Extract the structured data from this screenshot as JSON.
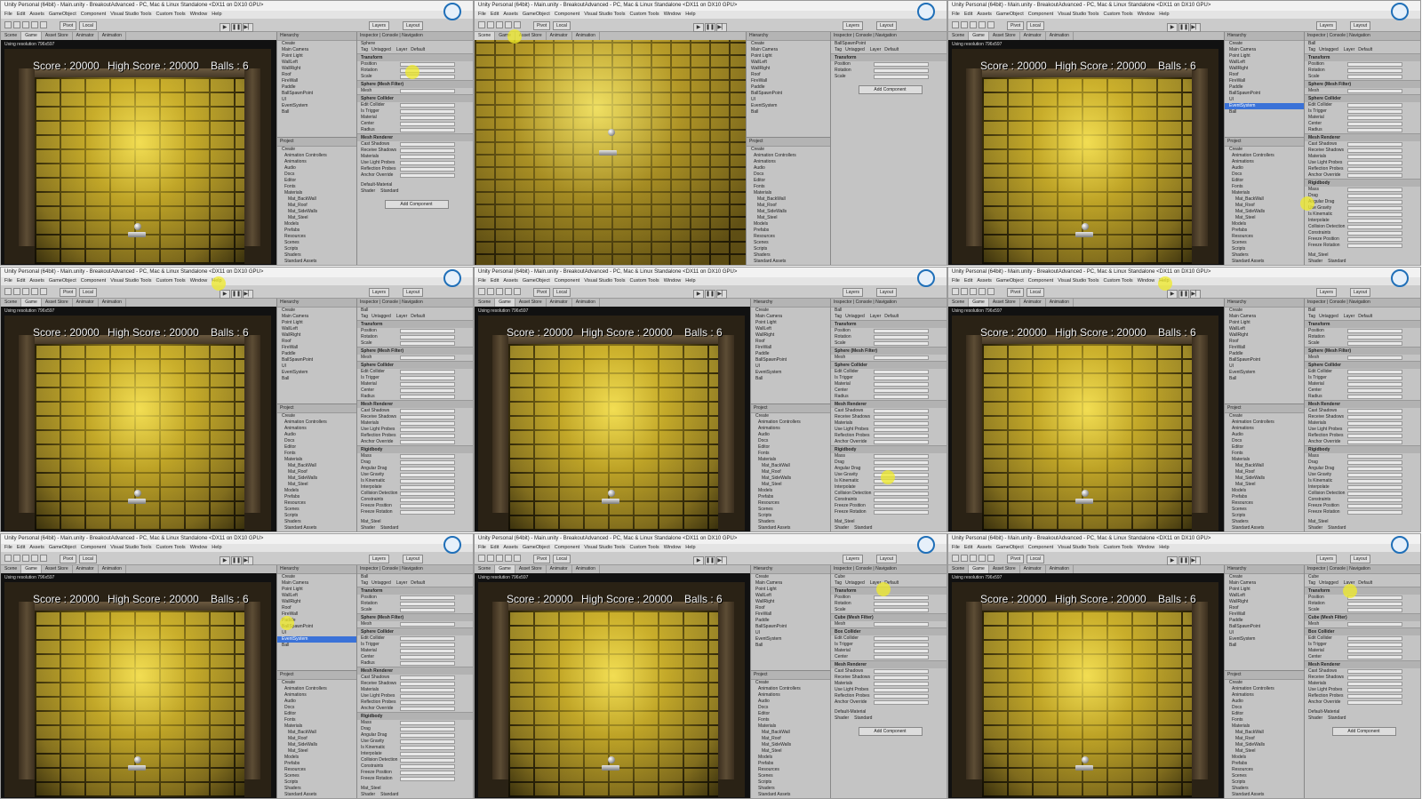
{
  "window": {
    "title": "Unity Personal (64bit) - Main.unity - BreakoutAdvanced - PC, Mac & Linux Standalone <DX11 on DX10 GPU>",
    "menu": [
      "File",
      "Edit",
      "Assets",
      "GameObject",
      "Component",
      "Visual Studio Tools",
      "Custom Tools",
      "Window",
      "Help"
    ]
  },
  "toolbar": {
    "pivot_label": "Pivot",
    "local_label": "Local",
    "layers_label": "Layers",
    "layout_label": "Layout",
    "account_label": "Account"
  },
  "tabs": {
    "scene": "Scene",
    "game": "Game",
    "asset_store": "Asset Store",
    "animator": "Animator",
    "animation": "Animation",
    "hierarchy": "Hierarchy",
    "project": "Project",
    "inspector": "Inspector",
    "console": "Console",
    "navigation": "Navigation"
  },
  "game_view": {
    "display_label": "Standalone (1024x768)",
    "maximize_label": "Maximize on Play",
    "mute_label": "Mute audio",
    "stats_label": "Stats",
    "gizmos_label": "Gizmos",
    "resolution_note": "Using resolution 796x597"
  },
  "hud": {
    "score": "Score : 20000",
    "high_score": "High Score : 20000",
    "balls": "Balls : 6"
  },
  "hierarchy": {
    "create_label": "Create",
    "items": [
      "Main Camera",
      "Point Light",
      "WallLeft",
      "WallRight",
      "Roof",
      "FireWall",
      "Paddle",
      "BallSpawnPoint",
      "UI",
      "EventSystem",
      "Ball"
    ]
  },
  "project": {
    "create_label": "Create",
    "folders": [
      "Animation Controllers",
      "Animations",
      "Audio",
      "Docs",
      "Editor",
      "Fonts",
      "Materials",
      "Mat_BackWall",
      "Mat_Roof",
      "Mat_SideWalls",
      "Mat_Steel",
      "Models",
      "Prefabs",
      "Resources",
      "Scenes",
      "Scripts",
      "Shaders",
      "Standard Assets",
      "Textures",
      "UnityUI"
    ]
  },
  "inspector": {
    "object_sphere": "Sphere",
    "object_ball": "Ball",
    "object_cube": "Cube",
    "object_spawn": "BallSpawnPoint",
    "tag_label": "Tag",
    "untagged": "Untagged",
    "layer_label": "Layer",
    "default_layer": "Default",
    "static_label": "Static",
    "components": {
      "transform": "Transform",
      "sphere_mesh_filter": "Sphere (Mesh Filter)",
      "sphere_collider": "Sphere Collider",
      "mesh_renderer": "Mesh Renderer",
      "rigidbody": "Rigidbody",
      "cube_mesh_filter": "Cube (Mesh Filter)",
      "box_collider": "Box Collider",
      "capsule_mesh_filter": "Capsule (Mesh Filter)",
      "capsule_collider": "Capsule Collider"
    },
    "fields": [
      "Position",
      "Rotation",
      "Scale",
      "Mesh",
      "Edit Collider",
      "Is Trigger",
      "Material",
      "Center",
      "Radius",
      "Cast Shadows",
      "Receive Shadows",
      "Materials",
      "Use Light Probes",
      "Reflection Probes",
      "Anchor Override",
      "Mass",
      "Drag",
      "Angular Drag",
      "Use Gravity",
      "Is Kinematic",
      "Interpolate",
      "Collision Detection",
      "Constraints",
      "Freeze Position",
      "Freeze Rotation"
    ],
    "material_default": "Default-Material",
    "material_steel": "Mat_Steel",
    "shader_label": "Shader",
    "shader_standard": "Standard",
    "add_component": "Add Component"
  },
  "colors": {
    "selection_blue": "#3a72d8",
    "cursor_highlight": "#f0eb28",
    "hud_text": "#f0f0f0",
    "editor_gray": "#c4c4c4"
  }
}
